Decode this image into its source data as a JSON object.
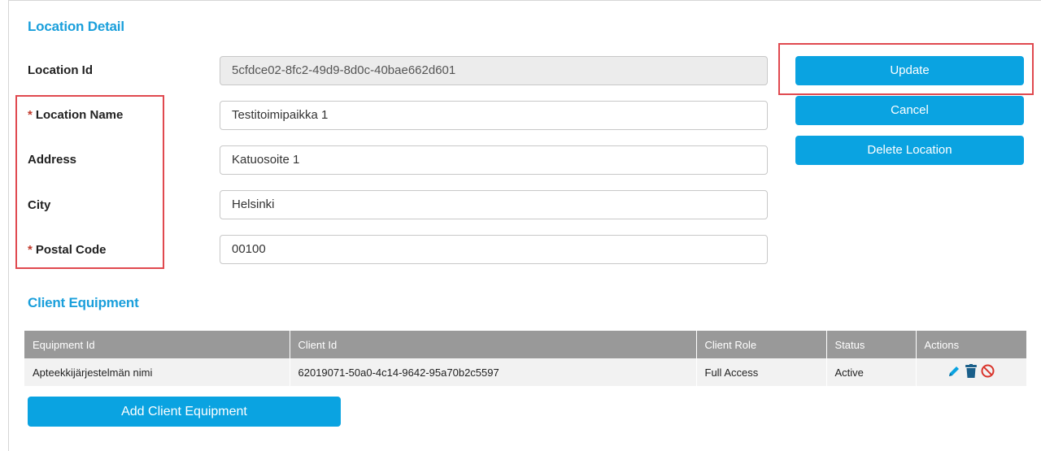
{
  "location_detail": {
    "title": "Location Detail",
    "fields": {
      "location_id": {
        "label": "Location Id",
        "value": "5cfdce02-8fc2-49d9-8d0c-40bae662d601",
        "readonly": true
      },
      "location_name": {
        "label": "Location Name",
        "required_mark": "*",
        "value": "Testitoimipaikka 1"
      },
      "address": {
        "label": "Address",
        "value": "Katuosoite 1"
      },
      "city": {
        "label": "City",
        "value": "Helsinki"
      },
      "postal_code": {
        "label": "Postal Code",
        "required_mark": "*",
        "value": "00100"
      }
    },
    "buttons": {
      "update": "Update",
      "cancel": "Cancel",
      "delete": "Delete Location"
    }
  },
  "client_equipment": {
    "title": "Client Equipment",
    "columns": [
      "Equipment Id",
      "Client Id",
      "Client Role",
      "Status",
      "Actions"
    ],
    "rows": [
      {
        "equipment_id": "Apteekkijärjestelmän nimi",
        "client_id": "62019071-50a0-4c14-9642-95a70b2c5597",
        "client_role": "Full Access",
        "status": "Active",
        "actions": [
          "edit-icon",
          "delete-icon",
          "disable-icon"
        ]
      }
    ],
    "add_button": "Add Client Equipment"
  },
  "colors": {
    "accent": "#0aa3e1",
    "title": "#1a9fdb",
    "required": "#c0392b",
    "highlight": "#e0494f",
    "table_header": "#999999"
  }
}
